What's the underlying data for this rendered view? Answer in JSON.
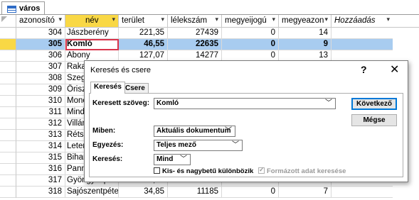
{
  "table_tab": {
    "label": "város"
  },
  "columns": [
    {
      "label": "azonosító",
      "arrow": "▾"
    },
    {
      "label": "név",
      "arrow": "▾"
    },
    {
      "label": "terület",
      "arrow": "▾"
    },
    {
      "label": "lélekszám",
      "arrow": "▾"
    },
    {
      "label": "megyeijogú",
      "arrow": "▾"
    },
    {
      "label": "megyeazon",
      "arrow": "▾"
    },
    {
      "label": "Hozzáadás",
      "arrow": "▾"
    }
  ],
  "rows": [
    {
      "id": "304",
      "name": "Jászberény",
      "area": "221,35",
      "pop": "27439",
      "county_seat": "0",
      "county": "14"
    },
    {
      "id": "305",
      "name": "Komló",
      "area": "46,55",
      "pop": "22635",
      "county_seat": "0",
      "county": "9"
    },
    {
      "id": "306",
      "name": "Abony",
      "area": "127,07",
      "pop": "14277",
      "county_seat": "0",
      "county": "13"
    },
    {
      "id": "307",
      "name": "Rakamaz",
      "area": "",
      "pop": "",
      "county_seat": "",
      "county": ""
    },
    {
      "id": "308",
      "name": "Szeghalom",
      "area": "",
      "pop": "",
      "county_seat": "",
      "county": ""
    },
    {
      "id": "309",
      "name": "Őriszentpéter",
      "area": "",
      "pop": "",
      "county_seat": "",
      "county": ""
    },
    {
      "id": "310",
      "name": "Monor",
      "area": "",
      "pop": "",
      "county_seat": "",
      "county": ""
    },
    {
      "id": "311",
      "name": "Mindszent",
      "area": "",
      "pop": "",
      "county_seat": "",
      "county": ""
    },
    {
      "id": "312",
      "name": "Villány",
      "area": "",
      "pop": "",
      "county_seat": "",
      "county": ""
    },
    {
      "id": "313",
      "name": "Rétság",
      "area": "",
      "pop": "",
      "county_seat": "",
      "county": ""
    },
    {
      "id": "314",
      "name": "Letenye",
      "area": "",
      "pop": "",
      "county_seat": "",
      "county": ""
    },
    {
      "id": "315",
      "name": "Biharkeresztes",
      "area": "",
      "pop": "",
      "county_seat": "",
      "county": ""
    },
    {
      "id": "316",
      "name": "Pannonhalma",
      "area": "",
      "pop": "",
      "county_seat": "",
      "county": ""
    },
    {
      "id": "317",
      "name": "Gyöngyöspata",
      "area": "60,75",
      "pop": "2565",
      "county_seat": "0",
      "county": "5"
    },
    {
      "id": "318",
      "name": "Sajószentpéter",
      "area": "34,85",
      "pop": "11185",
      "county_seat": "0",
      "county": "7"
    }
  ],
  "dialog": {
    "title": "Keresés és csere",
    "help": "?",
    "close": "✕",
    "tabs": [
      "Keresés",
      "Csere"
    ],
    "search_label": "Keresett szöveg:",
    "search_value": "Komló",
    "find_next": "Következő",
    "cancel": "Mégse",
    "look_in_label": "Miben:",
    "look_in_value": "Aktuális dokumentum",
    "match_label": "Egyezés:",
    "match_value": "Teljes mező",
    "direction_label": "Keresés:",
    "direction_value": "Mind",
    "match_case": "Kis- és nagybetű különbözik",
    "formatted": "Formázott adat keresése"
  }
}
